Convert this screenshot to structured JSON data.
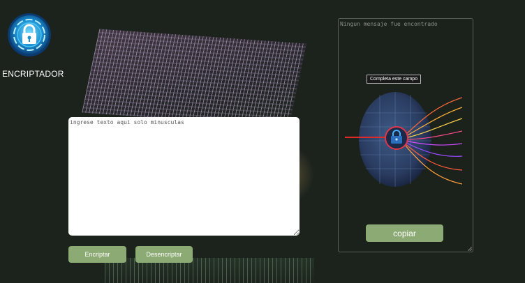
{
  "brand": {
    "name": "ENCRIPTADOR",
    "logo_icon": "padlock-shield-icon"
  },
  "input": {
    "placeholder": "ingrese texto aqui solo minusculas",
    "value": ""
  },
  "buttons": {
    "encrypt_label": "Encriptar",
    "decrypt_label": "Desencriptar",
    "copy_label": "copiar"
  },
  "output": {
    "placeholder": "Ningun mensaje fue encontrado",
    "value": "",
    "tooltip": "Completa este campo",
    "illustration_icon": "cyber-lock-globe-icon"
  },
  "colors": {
    "background": "#1c231d",
    "button": "#8cab74",
    "button_text": "#ffffff",
    "panel_border": "#5a5e58"
  }
}
